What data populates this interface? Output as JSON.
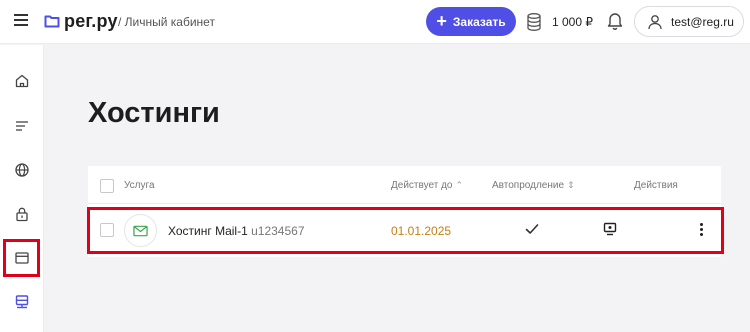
{
  "header": {
    "logo_text": "рег.ру",
    "breadcrumb": "/ Личный кабинет",
    "order_button": "Заказать",
    "balance": "1 000 ₽",
    "user_email": "test@reg.ru"
  },
  "sidebar": {
    "items": [
      "home-icon",
      "list-icon",
      "globe-icon",
      "lock-icon",
      "browser-window-icon",
      "hosting-server-icon"
    ],
    "active_item": "hosting-server-icon"
  },
  "page": {
    "title": "Хостинги"
  },
  "table": {
    "columns": {
      "service": "Услуга",
      "expires": "Действует до",
      "autorenew": "Автопродление",
      "actions": "Действия"
    },
    "rows": [
      {
        "name": "Хостинг Mail-1",
        "id": "u1234567",
        "expires": "01.01.2025",
        "autorenew": true,
        "icon": "mail-icon"
      }
    ]
  },
  "colors": {
    "accent": "#4f4fe6",
    "highlight": "#e1001a",
    "date": "#c67d16",
    "mail_icon": "#3aa64a"
  }
}
